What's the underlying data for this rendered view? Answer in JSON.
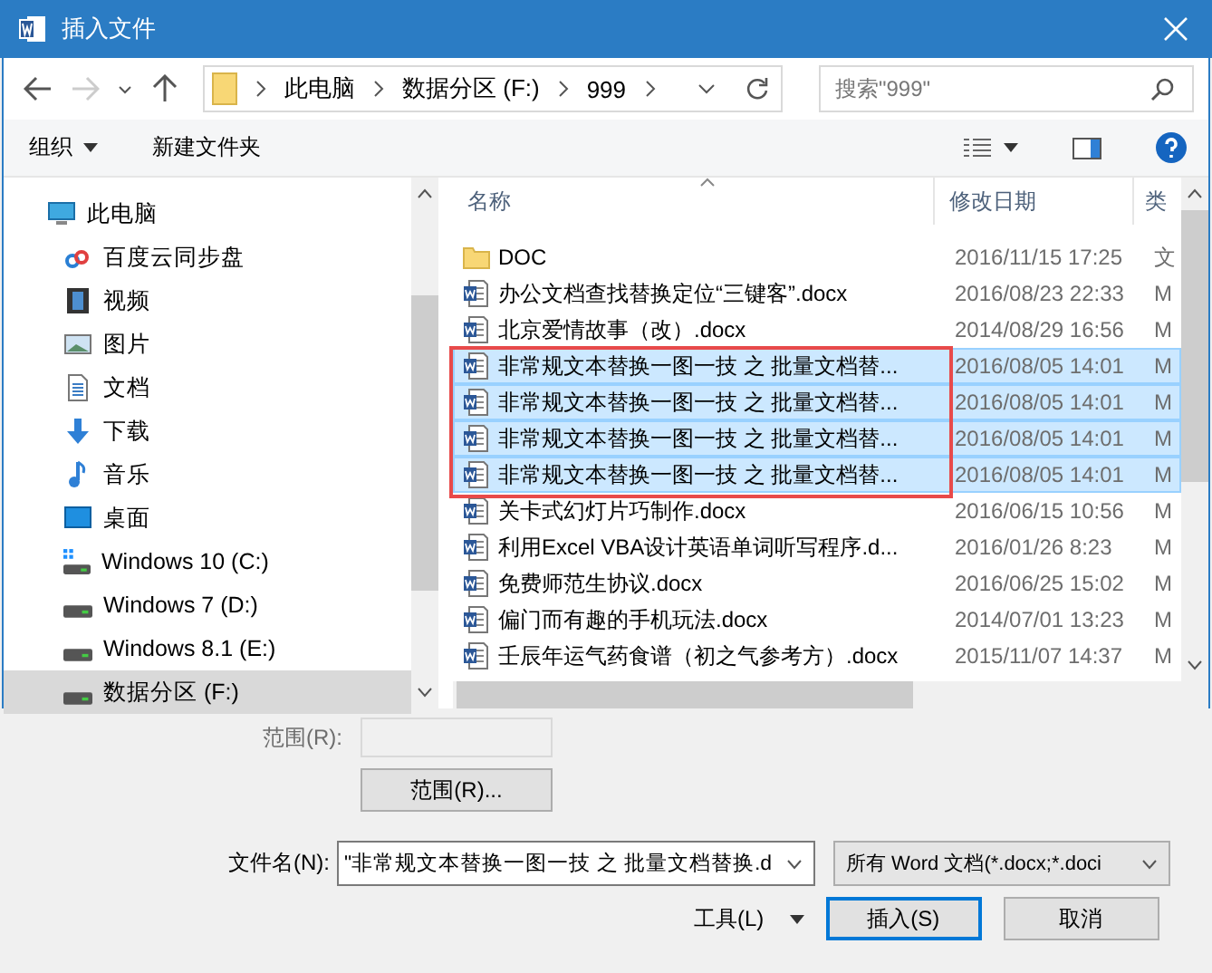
{
  "window": {
    "title": "插入文件"
  },
  "address": {
    "path": [
      "此电脑",
      "数据分区 (F:)",
      "999"
    ],
    "search_placeholder": "搜索\"999\""
  },
  "toolbar": {
    "organize": "组织",
    "new_folder": "新建文件夹"
  },
  "sidebar": {
    "items": [
      {
        "label": "此电脑",
        "kind": "pc",
        "selected": false
      },
      {
        "label": "百度云同步盘",
        "kind": "cloud",
        "selected": false
      },
      {
        "label": "视频",
        "kind": "video",
        "selected": false
      },
      {
        "label": "图片",
        "kind": "picture",
        "selected": false
      },
      {
        "label": "文档",
        "kind": "docs",
        "selected": false
      },
      {
        "label": "下载",
        "kind": "download",
        "selected": false
      },
      {
        "label": "音乐",
        "kind": "music",
        "selected": false
      },
      {
        "label": "桌面",
        "kind": "desktop",
        "selected": false
      },
      {
        "label": "Windows 10 (C:)",
        "kind": "windrive",
        "selected": false
      },
      {
        "label": "Windows 7 (D:)",
        "kind": "drive",
        "selected": false
      },
      {
        "label": "Windows 8.1 (E:)",
        "kind": "drive",
        "selected": false
      },
      {
        "label": "数据分区 (F:)",
        "kind": "drive",
        "selected": true
      }
    ]
  },
  "columns": [
    "名称",
    "修改日期",
    "类"
  ],
  "files": [
    {
      "kind": "folder",
      "name": "DOC",
      "date": "2016/11/15 17:25",
      "type": "文",
      "selected": false
    },
    {
      "kind": "doc",
      "name": "办公文档查找替换定位“三键客”.docx",
      "date": "2016/08/23 22:33",
      "type": "M",
      "selected": false
    },
    {
      "kind": "doc",
      "name": "北京爱情故事（改）.docx",
      "date": "2014/08/29 16:56",
      "type": "M",
      "selected": false
    },
    {
      "kind": "doc",
      "name": "非常规文本替换一图一技 之 批量文档替...",
      "date": "2016/08/05 14:01",
      "type": "M",
      "selected": true
    },
    {
      "kind": "doc",
      "name": "非常规文本替换一图一技 之 批量文档替...",
      "date": "2016/08/05 14:01",
      "type": "M",
      "selected": true
    },
    {
      "kind": "doc",
      "name": "非常规文本替换一图一技 之 批量文档替...",
      "date": "2016/08/05 14:01",
      "type": "M",
      "selected": true
    },
    {
      "kind": "doc",
      "name": "非常规文本替换一图一技 之 批量文档替...",
      "date": "2016/08/05 14:01",
      "type": "M",
      "selected": true
    },
    {
      "kind": "doc",
      "name": "关卡式幻灯片巧制作.docx",
      "date": "2016/06/15 10:56",
      "type": "M",
      "selected": false
    },
    {
      "kind": "doc",
      "name": "利用Excel VBA设计英语单词听写程序.d...",
      "date": "2016/01/26 8:23",
      "type": "M",
      "selected": false
    },
    {
      "kind": "doc",
      "name": "免费师范生协议.docx",
      "date": "2016/06/25 15:02",
      "type": "M",
      "selected": false
    },
    {
      "kind": "doc",
      "name": "偏门而有趣的手机玩法.docx",
      "date": "2014/07/01 13:23",
      "type": "M",
      "selected": false
    },
    {
      "kind": "doc",
      "name": "壬辰年运气药食谱（初之气参考方）.docx",
      "date": "2015/11/07 14:37",
      "type": "M",
      "selected": false
    }
  ],
  "range": {
    "label": "范围(R):",
    "button": "范围(R)..."
  },
  "filename": {
    "label": "文件名(N):",
    "value": "\"非常规文本替换一图一技 之 批量文档替换.d"
  },
  "filetype": {
    "value": "所有 Word 文档(*.docx;*.doci"
  },
  "tools": "工具(L)",
  "buttons": {
    "insert": "插入(S)",
    "cancel": "取消"
  }
}
